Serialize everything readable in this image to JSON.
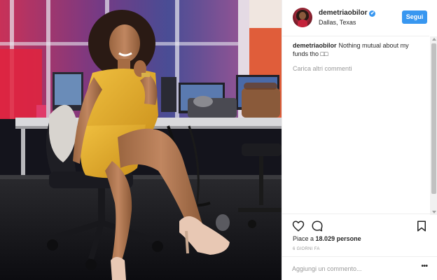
{
  "post": {
    "photo_alt": "Woman in yellow dress sitting on an office chair in a TV newsroom"
  },
  "header": {
    "username": "demetriaobilor",
    "verified_mark": "✔",
    "location": "Dallas, Texas",
    "follow_label": "Segui"
  },
  "caption": {
    "username": "demetriaobilor",
    "text": "Nothing mutual about my funds tho □□"
  },
  "comments": {
    "load_more_label": "Carica altri commenti"
  },
  "actions": {
    "like_icon": "heart-icon",
    "comment_icon": "speech-bubble-icon",
    "save_icon": "bookmark-icon"
  },
  "likes": {
    "prefix": "Piace a",
    "count": "18.029",
    "suffix": "persone"
  },
  "timestamp": "6 GIORNI FA",
  "add_comment": {
    "placeholder": "Aggiungi un commento...",
    "more_label": "•••"
  },
  "colors": {
    "accent": "#3897f0",
    "dress": "#e0ad2a",
    "muted_text": "#999999"
  }
}
